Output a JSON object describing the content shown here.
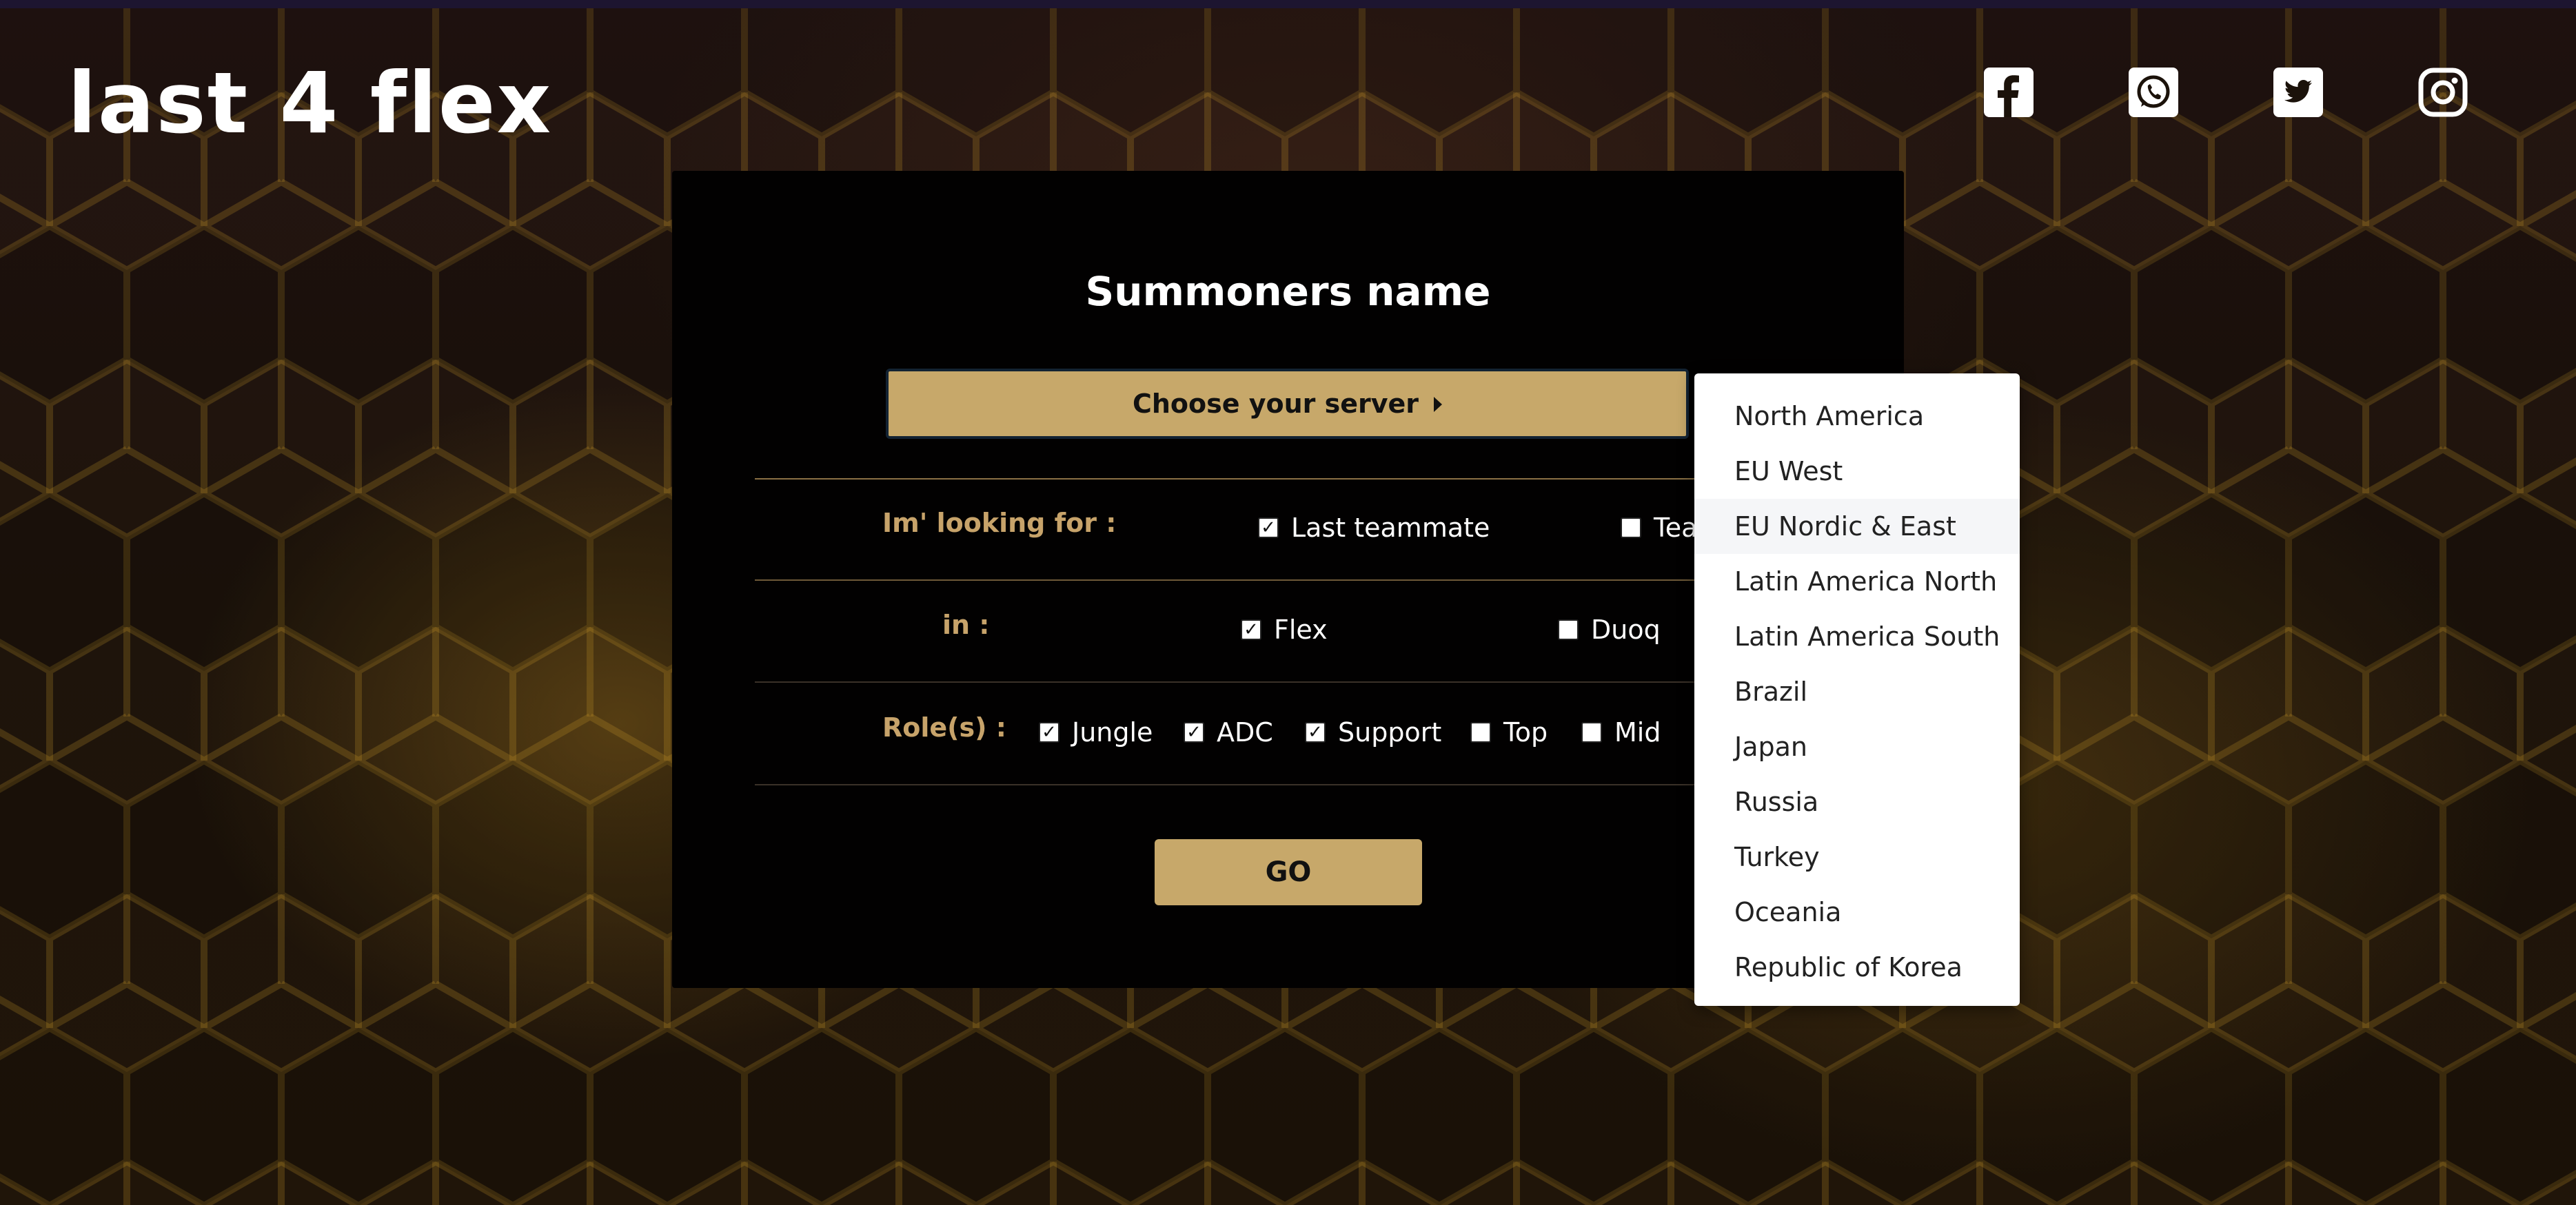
{
  "header": {
    "logo_text": "last 4 flex",
    "socials": [
      {
        "name": "facebook-icon"
      },
      {
        "name": "whatsapp-icon"
      },
      {
        "name": "twitter-icon"
      },
      {
        "name": "instagram-icon"
      }
    ]
  },
  "form": {
    "title": "Summoners name",
    "server_button_label": "Choose your server",
    "looking_for": {
      "label": "Im' looking for :",
      "options": [
        {
          "label": "Last teammate",
          "checked": true
        },
        {
          "label": "Tea",
          "checked": false
        }
      ]
    },
    "queue": {
      "label": "in :",
      "options": [
        {
          "label": "Flex",
          "checked": true
        },
        {
          "label": "Duoq",
          "checked": false
        }
      ]
    },
    "roles": {
      "label": "Role(s) :",
      "options": [
        {
          "label": "Jungle",
          "checked": true
        },
        {
          "label": "ADC",
          "checked": true
        },
        {
          "label": "Support",
          "checked": true
        },
        {
          "label": "Top",
          "checked": false
        },
        {
          "label": "Mid",
          "checked": false
        }
      ]
    },
    "go_label": "GO"
  },
  "server_dropdown": {
    "highlighted": "EU Nordic & East",
    "options": [
      "North America",
      "EU West",
      "EU Nordic & East",
      "Latin America North",
      "Latin America South",
      "Brazil",
      "Japan",
      "Russia",
      "Turkey",
      "Oceania",
      "Republic of Korea"
    ]
  },
  "colors": {
    "accent_gold": "#c7a86a",
    "label_gold": "#c7a36a",
    "panel_bg": "#020101"
  }
}
